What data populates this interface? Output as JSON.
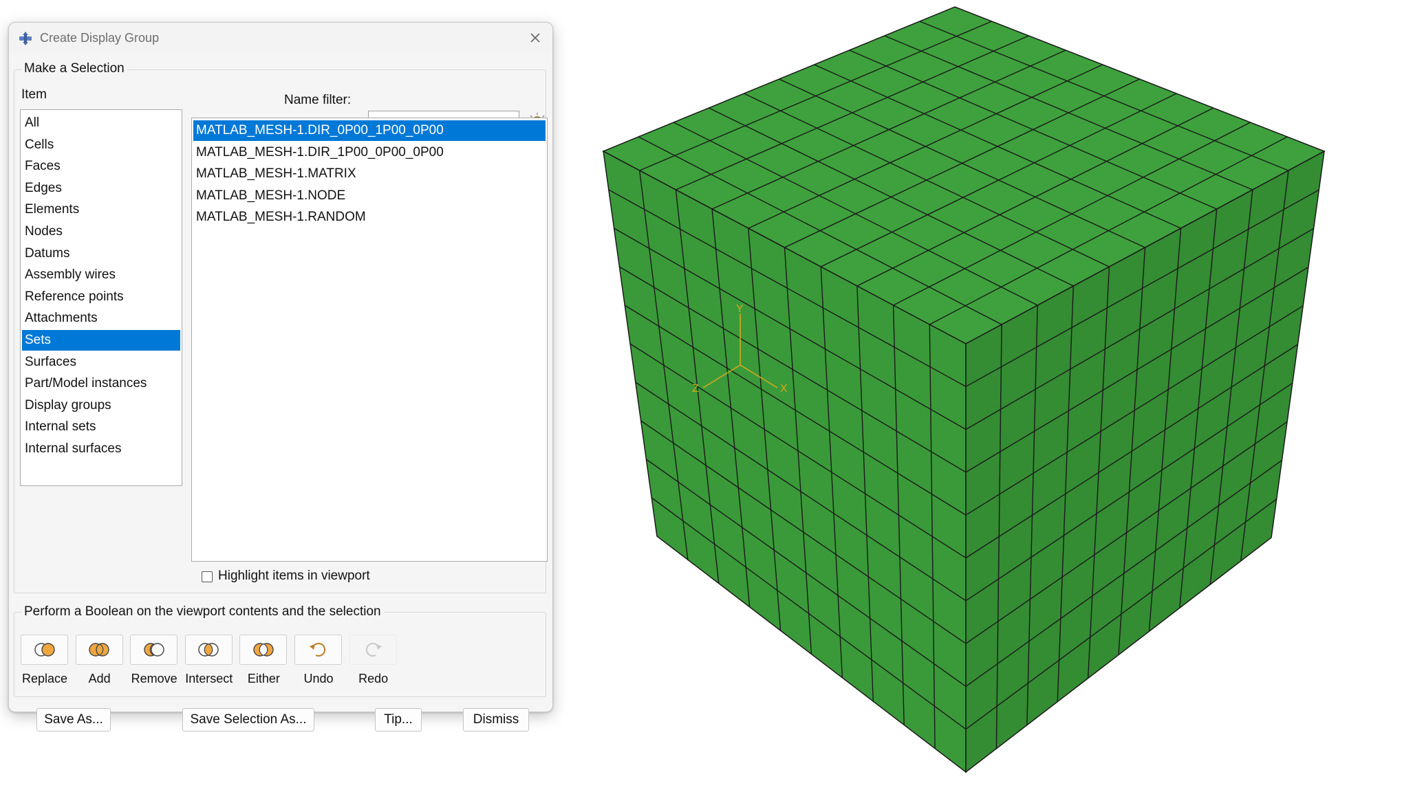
{
  "window": {
    "title": "Create Display Group"
  },
  "selection_group": {
    "label": "Make a Selection",
    "item_label": "Item",
    "items": [
      {
        "label": "All",
        "selected": false
      },
      {
        "label": "Cells",
        "selected": false
      },
      {
        "label": "Faces",
        "selected": false
      },
      {
        "label": "Edges",
        "selected": false
      },
      {
        "label": "Elements",
        "selected": false
      },
      {
        "label": "Nodes",
        "selected": false
      },
      {
        "label": "Datums",
        "selected": false
      },
      {
        "label": "Assembly wires",
        "selected": false
      },
      {
        "label": "Reference points",
        "selected": false
      },
      {
        "label": "Attachments",
        "selected": false
      },
      {
        "label": "Sets",
        "selected": true
      },
      {
        "label": "Surfaces",
        "selected": false
      },
      {
        "label": "Part/Model instances",
        "selected": false
      },
      {
        "label": "Display groups",
        "selected": false
      },
      {
        "label": "Internal sets",
        "selected": false
      },
      {
        "label": "Internal surfaces",
        "selected": false
      }
    ],
    "name_filter_label": "Name filter:",
    "name_filter_value": "",
    "sets": [
      {
        "label": "MATLAB_MESH-1.DIR_0P00_1P00_0P00",
        "selected": true
      },
      {
        "label": "MATLAB_MESH-1.DIR_1P00_0P00_0P00",
        "selected": false
      },
      {
        "label": "MATLAB_MESH-1.MATRIX",
        "selected": false
      },
      {
        "label": "MATLAB_MESH-1.NODE",
        "selected": false
      },
      {
        "label": "MATLAB_MESH-1.RANDOM",
        "selected": false
      }
    ],
    "highlight_label": "Highlight items in viewport",
    "highlight_checked": false
  },
  "boolean_group": {
    "label": "Perform a Boolean on the viewport contents and the selection",
    "buttons": [
      {
        "label": "Replace",
        "icon": "replace-icon"
      },
      {
        "label": "Add",
        "icon": "add-icon"
      },
      {
        "label": "Remove",
        "icon": "remove-icon"
      },
      {
        "label": "Intersect",
        "icon": "intersect-icon"
      },
      {
        "label": "Either",
        "icon": "either-icon"
      },
      {
        "label": "Undo",
        "icon": "undo-icon"
      },
      {
        "label": "Redo",
        "icon": "redo-icon",
        "disabled": true
      }
    ]
  },
  "footer": {
    "save_as": "Save As...",
    "save_selection_as": "Save Selection As...",
    "tip": "Tip...",
    "dismiss": "Dismiss"
  },
  "viewport": {
    "mesh_color": "#3b9a3a",
    "edge_color": "#1a1a1a",
    "triad_color": "#d7a81a",
    "divisions": 10,
    "axes": {
      "x": "X",
      "y": "Y",
      "z": "Z"
    }
  }
}
